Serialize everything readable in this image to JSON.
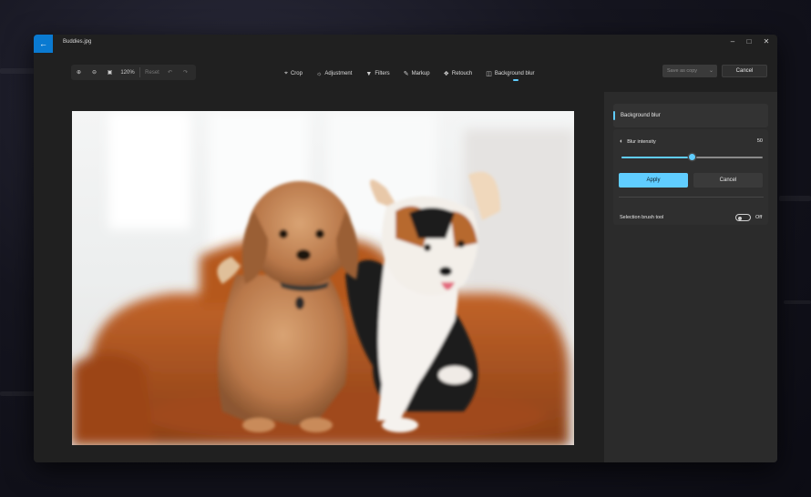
{
  "window": {
    "filename": "Buddies.jpg",
    "back_icon": "arrow-left-icon"
  },
  "zoombar": {
    "zoom_level": "120%",
    "reset_label": "Reset"
  },
  "toolbar": {
    "tools": [
      {
        "label": "Crop",
        "icon": "crop-icon"
      },
      {
        "label": "Adjustment",
        "icon": "brightness-icon"
      },
      {
        "label": "Filters",
        "icon": "filter-icon"
      },
      {
        "label": "Markup",
        "icon": "pen-icon"
      },
      {
        "label": "Retouch",
        "icon": "retouch-icon"
      },
      {
        "label": "Background blur",
        "icon": "background-blur-icon",
        "active": true
      }
    ],
    "save_label": "Save as copy",
    "cancel_label": "Cancel"
  },
  "panel": {
    "title": "Background blur",
    "blur_label": "Blur intensity",
    "blur_value": "50",
    "blur_level_fraction": 0.5,
    "apply_label": "Apply",
    "cancel_label": "Cancel",
    "brush_label": "Selection brush tool",
    "brush_state": "Off"
  },
  "colors": {
    "accent": "#60cdff",
    "title_back": "#0a7ad1",
    "window_bg": "#202020",
    "panel_bg": "#2b2b2b"
  }
}
